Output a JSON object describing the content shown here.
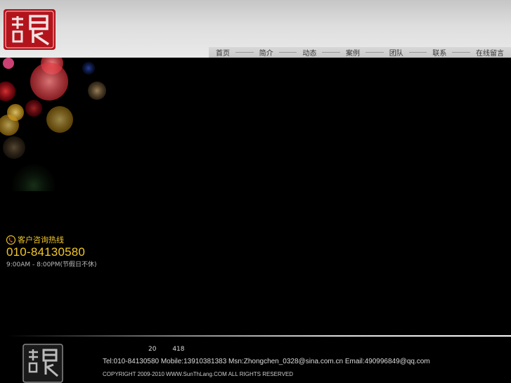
{
  "nav": {
    "items": [
      "首页",
      "简介",
      "动态",
      "案例",
      "团队",
      "联系",
      "在线留言"
    ]
  },
  "hotline": {
    "label": "客户咨询热线",
    "number": "010-84130580",
    "hours": "9:00AM - 8:00PM(节假日不休)"
  },
  "footer": {
    "ids": [
      "20",
      "418"
    ],
    "contact": "Tel:010-84130580 Mobile:13910381383 Msn:Zhongchen_0328@sina.com.cn Email:490996849@qq.com",
    "copyright": "COPYRIGHT 2009-2010 WWW.SunThLang.COM ALL RIGHTS RESERVED"
  },
  "icons": {
    "logo": "seal-logo-icon",
    "phone": "phone-icon"
  },
  "colors": {
    "accent": "#f4c726",
    "logo_red": "#b3141c"
  }
}
